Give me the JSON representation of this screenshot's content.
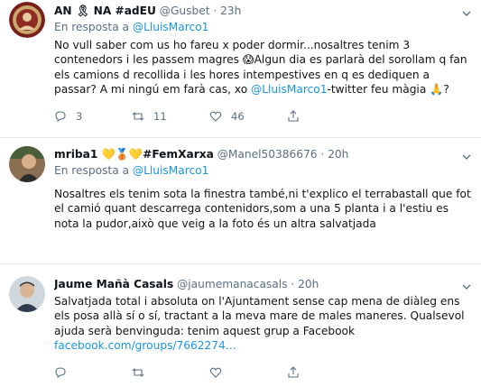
{
  "tweets": [
    {
      "name": "AN",
      "name_badge": "🎗",
      "name_rest": " NA #adEU",
      "handle": "@Gusbet",
      "time": "23h",
      "reply_prefix": "En resposta a",
      "reply_to": "@LluisMarco1",
      "text_a": "No vull saber com us ho fareu x poder dormir...nosaltres tenim 3 contenedors i les passem magres ",
      "text_emoji": "😱",
      "text_b": "Algun dia es parlarà del sorollam q fan els camions d recollida i les hores intempestives en q es dediquen a passar? A mi ningú em farà cas, xo ",
      "text_mention": "@LluisMarco1",
      "text_c": "-twitter feu màgia ",
      "text_emoji2": "🙏",
      "text_d": "?",
      "replies": "3",
      "retweets": "11",
      "likes": "46"
    },
    {
      "name": "mriba1",
      "name_emoji": "💛🥉💛",
      "name_rest": "#FemXarxa",
      "handle": "@Manel50386676",
      "time": "20h",
      "reply_prefix": "En resposta a",
      "reply_to": "@LluisMarco1",
      "text": "Nosaltres els tenim sota la finestra també,ni t'explico el terrabastall que fot el camió quant descarrega contenidors,som a una 5 planta i a l'estiu es nota la pudor,això que veig a la foto és un altra salvatjada"
    },
    {
      "name": "Jaume Mañà Casals",
      "handle": "@jaumemanacasals",
      "time": "20h",
      "text": "Salvatjada total i absoluta on l'Ajuntament sense cap mena de diàleg ens els posa allà sí o sí, tractant a la meva mare de males maneres. Qualsevol ajuda serà benvinguda: tenim aquest grup a Facebook",
      "link": "facebook.com/groups/7662274…"
    }
  ],
  "colors": {
    "link": "#1b95e0",
    "muted": "#5b7083",
    "border": "#e6ecf0"
  },
  "icons": [
    "reply-icon",
    "retweet-icon",
    "like-icon",
    "share-icon",
    "chevron-down-icon"
  ]
}
